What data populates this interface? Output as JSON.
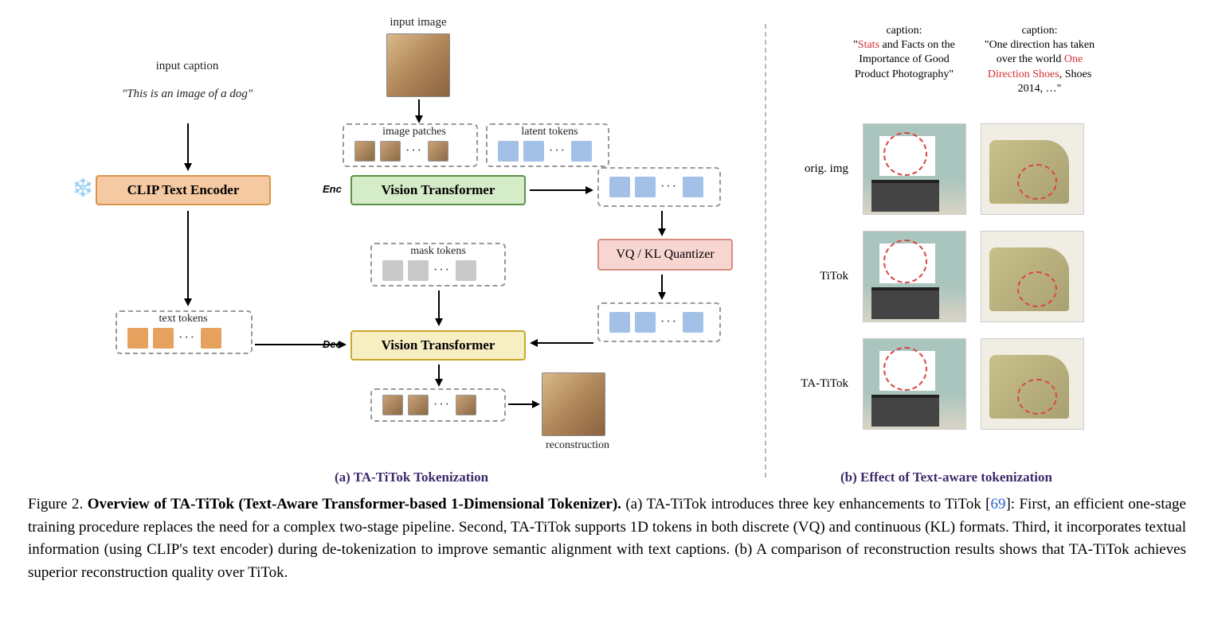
{
  "panelA": {
    "inputCaptionLabel": "input caption",
    "inputCaptionText": "\"This is an image of a dog\"",
    "inputImageLabel": "input image",
    "clipBlock": "CLIP Text Encoder",
    "vitEnc": "Vision Transformer",
    "vitDec": "Vision Transformer",
    "quantizer": "VQ / KL Quantizer",
    "imagePatchesLabel": "image patches",
    "latentTokensLabel": "latent tokens",
    "maskTokensLabel": "mask tokens",
    "textTokensLabel": "text tokens",
    "encLabel": "Enc",
    "decLabel": "Dec",
    "reconstructionLabel": "reconstruction",
    "subtitle": "(a) TA-TiTok Tokenization"
  },
  "panelB": {
    "caption1Label": "caption:",
    "caption1Pre": "\"",
    "caption1Red": "Stats",
    "caption1Post": " and Facts on the Importance of Good Product Photography\"",
    "caption2Label": "caption:",
    "caption2Pre": "\"One direction has taken over the world ",
    "caption2Red": "One Direction Shoes",
    "caption2Post": ", Shoes 2014, …\"",
    "rows": [
      "orig. img",
      "TiTok",
      "TA-TiTok"
    ],
    "subtitle": "(b) Effect of Text-aware tokenization"
  },
  "figureCaption": {
    "label": "Figure 2.",
    "titleBold": "Overview of TA-TiTok (Text-Aware Transformer-based 1-Dimensional Tokenizer).",
    "text1": " (a) TA-TiTok introduces three key enhancements to TiTok [",
    "ref": "69",
    "text2": "]: First, an efficient one-stage training procedure replaces the need for a complex two-stage pipeline. Second, TA-TiTok supports 1D tokens in both discrete (VQ) and continuous (KL) formats. Third, it incorporates textual information (using CLIP's text encoder) during de-tokenization to improve semantic alignment with text captions. (b) A comparison of reconstruction results shows that TA-TiTok achieves superior reconstruction quality over TiTok."
  }
}
